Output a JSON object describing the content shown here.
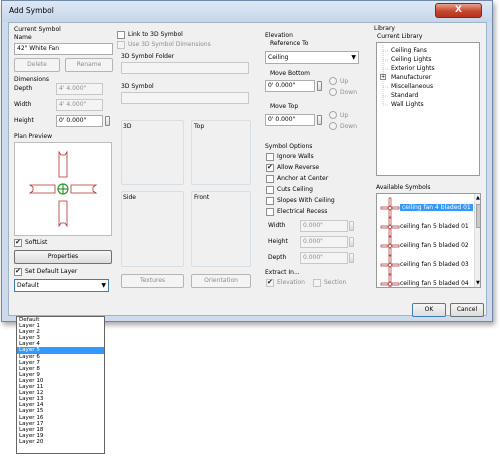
{
  "window": {
    "title": "Add Symbol",
    "close_glyph": "X"
  },
  "current_symbol": {
    "group_label": "Current Symbol",
    "name_label": "Name",
    "name_value": "42\" White Fan",
    "delete_label": "Delete",
    "rename_label": "Rename"
  },
  "dimensions": {
    "label": "Dimensions",
    "depth_label": "Depth",
    "depth_value": "4' 4.000\"",
    "width_label": "Width",
    "width_value": "4' 4.000\"",
    "height_label": "Height",
    "height_value": "0' 0.000\""
  },
  "plan_preview": {
    "label": "Plan Preview"
  },
  "softlist": {
    "label": "SoftList",
    "checked": true
  },
  "properties_label": "Properties",
  "default_layer": {
    "checkbox_label": "Set Default Layer",
    "checked": true,
    "selected": "Default",
    "options": [
      "Default",
      "Layer 1",
      "Layer 2",
      "Layer 3",
      "Layer 4",
      "Layer 5",
      "Layer 6",
      "Layer 7",
      "Layer 8",
      "Layer 9",
      "Layer 10",
      "Layer 11",
      "Layer 12",
      "Layer 13",
      "Layer 14",
      "Layer 15",
      "Layer 16",
      "Layer 17",
      "Layer 18",
      "Layer 19",
      "Layer 20"
    ],
    "highlighted": "Layer 5"
  },
  "link3d": {
    "link_label": "Link to 3D Symbol",
    "use_dims_label": "Use 3D Symbol Dimensions",
    "folder_label": "3D Symbol Folder",
    "symbol_label": "3D Symbol",
    "view_3d": "3D",
    "view_top": "Top",
    "view_side": "Side",
    "view_front": "Front",
    "textures_label": "Textures",
    "orientation_label": "Orientation"
  },
  "elevation": {
    "label": "Elevation",
    "reference_label": "Reference To",
    "reference_value": "Ceiling",
    "move_bottom_label": "Move Bottom",
    "move_bottom_value": "0' 0.000\"",
    "move_top_label": "Move Top",
    "move_top_value": "0' 0.000\"",
    "up_label": "Up",
    "down_label": "Down"
  },
  "symbol_options": {
    "label": "Symbol Options",
    "items": [
      {
        "label": "Ignore Walls",
        "checked": false
      },
      {
        "label": "Allow Reverse",
        "checked": true
      },
      {
        "label": "Anchor at Center",
        "checked": false
      },
      {
        "label": "Cuts Ceiling",
        "checked": false
      },
      {
        "label": "Slopes With Ceiling",
        "checked": false
      },
      {
        "label": "Electrical Recess",
        "checked": false
      }
    ],
    "width_label": "Width",
    "width_value": "0.000\"",
    "height_label": "Height",
    "height_value": "0.000\"",
    "depth_label": "Depth",
    "depth_value": "0.000\""
  },
  "extract": {
    "label": "Extract In...",
    "elevation_label": "Elevation",
    "section_label": "Section"
  },
  "library": {
    "label": "Library",
    "current_label": "Current Library",
    "tree": [
      "Ceiling Fans",
      "Ceiling Lights",
      "Exterior Lights",
      "Manufacturer",
      "Miscellaneous",
      "Standard",
      "Wall Lights"
    ],
    "expander": "+"
  },
  "available": {
    "label": "Available Symbols",
    "items": [
      "ceiling fan 4 bladed 01",
      "ceiling fan 5 bladed 01",
      "ceiling fan 5 bladed 02",
      "ceiling fan 5 bladed 03",
      "ceiling fan 5 bladed 04"
    ],
    "selected_index": 0
  },
  "footer": {
    "ok_label": "OK",
    "cancel_label": "Cancel"
  },
  "colors": {
    "selection": "#3399ff",
    "fan_outline": "#b03030",
    "fan_center": "#2a9a2a"
  }
}
